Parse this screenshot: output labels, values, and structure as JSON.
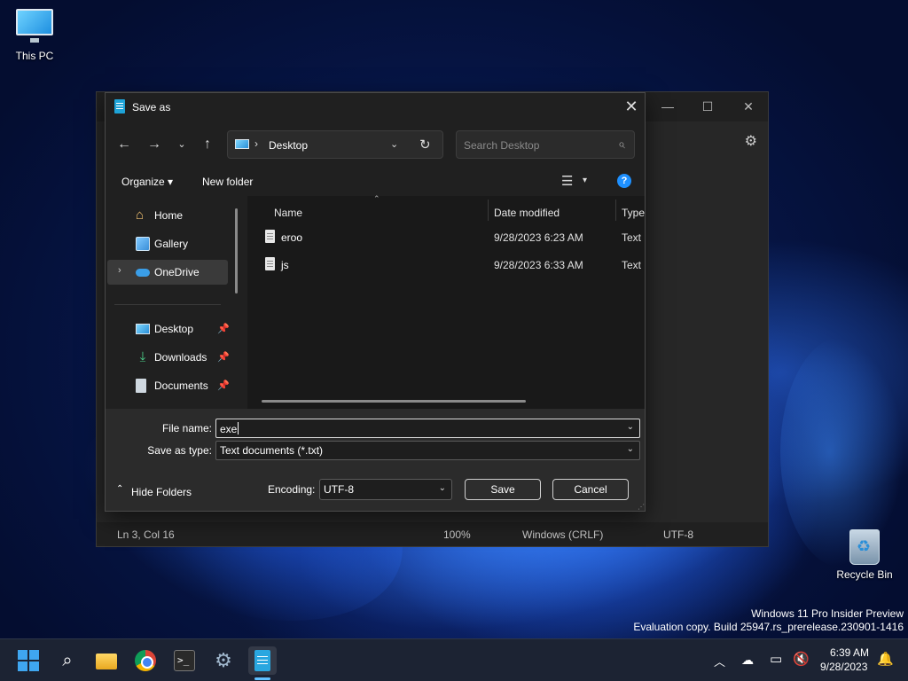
{
  "desktop": {
    "icons": [
      {
        "label": "This PC",
        "icon": "monitor-icon"
      },
      {
        "label": "Recycle Bin",
        "icon": "recycle-bin-icon"
      }
    ],
    "watermark": {
      "line1": "Windows 11 Pro Insider Preview",
      "line2": "Evaluation copy. Build 25947.rs_prerelease.230901-1416"
    }
  },
  "notepad": {
    "controls": {
      "minimize": "—",
      "maximize": "☐",
      "close": "✕"
    },
    "gear_icon": "⚙",
    "status": {
      "position": "Ln 3, Col 16",
      "zoom": "100%",
      "line_ending": "Windows (CRLF)",
      "encoding": "UTF-8"
    }
  },
  "dialog": {
    "title": "Save as",
    "close": "✕",
    "nav": {
      "back": "←",
      "forward": "→",
      "recent": "⌄",
      "up": "↑"
    },
    "address": {
      "separator": "›",
      "location": "Desktop",
      "chevron": "⌄",
      "refresh": "↻"
    },
    "search": {
      "placeholder": "Search Desktop",
      "icon": "⌕"
    },
    "commands": {
      "organize": "Organize ▾",
      "new_folder": "New folder",
      "view_icon": "☰",
      "view_chevron": "▾",
      "help": "?"
    },
    "nav_pane": {
      "expand": "›",
      "items": [
        {
          "label": "Home"
        },
        {
          "label": "Gallery"
        },
        {
          "label": "OneDrive"
        },
        {
          "label": "Desktop",
          "pinned": true
        },
        {
          "label": "Downloads",
          "pinned": true
        },
        {
          "label": "Documents",
          "pinned": true
        }
      ],
      "pin_glyph": "📌"
    },
    "columns": {
      "sort": "⌃",
      "name": "Name",
      "date": "Date modified",
      "type": "Type"
    },
    "files": [
      {
        "name": "eroo",
        "date": "9/28/2023 6:23 AM",
        "type": "Text D"
      },
      {
        "name": "js",
        "date": "9/28/2023 6:33 AM",
        "type": "Text D"
      }
    ],
    "form": {
      "file_name_label": "File name:",
      "file_name_value": "exe",
      "save_type_label": "Save as type:",
      "save_type_value": "Text documents (*.txt)",
      "chevron": "⌄",
      "hide_folders_chevron": "⌃",
      "hide_folders": "Hide Folders",
      "encoding_label": "Encoding:",
      "encoding_value": "UTF-8",
      "save": "Save",
      "cancel": "Cancel"
    }
  },
  "taskbar": {
    "apps": [
      "start-icon",
      "search-icon",
      "file-explorer-icon",
      "chrome-icon",
      "terminal-icon",
      "settings-icon",
      "notepad-icon"
    ],
    "search_glyph": "⌕",
    "terminal_glyph": ">_",
    "settings_glyph": "⚙",
    "tray": {
      "chevron": "︿",
      "cloud": "☁",
      "network": "▭",
      "volume": "🔇",
      "bell": "🔔"
    },
    "clock": {
      "time": "6:39 AM",
      "date": "9/28/2023"
    }
  },
  "colors": {
    "accent": "#3fa6f0",
    "dialog_bg": "#202020",
    "panel_bg": "#2b2b2b",
    "file_bg": "#191919"
  }
}
